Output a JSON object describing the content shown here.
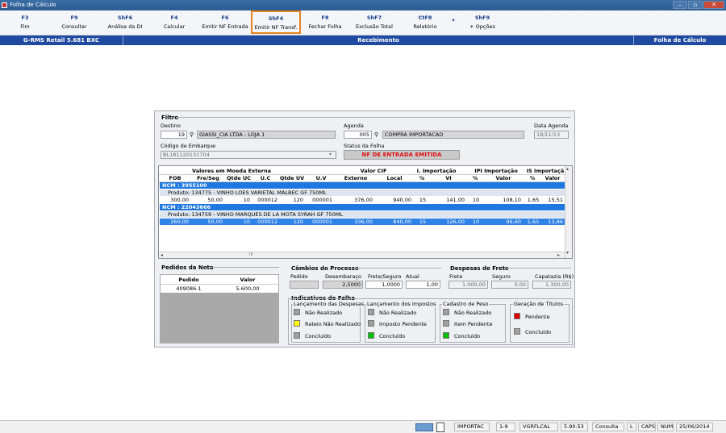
{
  "window": {
    "title": "Folha de Cálculo",
    "minimize": "–",
    "maximize": "▫",
    "close": "✕"
  },
  "toolbar": [
    {
      "key": "F3",
      "label": "Fim"
    },
    {
      "key": "F9",
      "label": "Consultar"
    },
    {
      "key": "ShF6",
      "label": "Análise da DI"
    },
    {
      "key": "F4",
      "label": "Calcular"
    },
    {
      "key": "F6",
      "label": "Emitir NF Entrada"
    },
    {
      "key": "ShF4",
      "label": "Emitir NF Transf."
    },
    {
      "key": "F8",
      "label": "Fechar Folha"
    },
    {
      "key": "ShF7",
      "label": "Exclusão Total"
    },
    {
      "key": "CtF8",
      "label": "Relatório"
    },
    {
      "key": "ShF9",
      "label": "+ Opções"
    }
  ],
  "header": {
    "left": "G-RMS Retail 5.681 BXC",
    "center": "Recebimento",
    "right": "Folha de Cálculo"
  },
  "filtro": {
    "title": "Filtro",
    "destino_label": "Destino",
    "destino_code": "19",
    "destino_name": "GIASSI_CIA LTDA - LOJA 1",
    "agenda_label": "Agenda",
    "agenda_code": "005",
    "agenda_name": "COMPRA IMPORTACAO",
    "data_agenda_label": "Data Agenda",
    "data_agenda": "18/11/13",
    "codigo_embarque_label": "Código de Embarque",
    "codigo_embarque": "BL181120131704",
    "status_label": "Status da Folha",
    "status": "NF DE ENTRADA EMITIDA"
  },
  "grid": {
    "group_headers": [
      "Valores em Moeda Externa",
      "Valor CIF",
      "I. Importação",
      "IPI Importação",
      "IS Importaçã"
    ],
    "columns": [
      "FOB",
      "Fre/Seg",
      "Qtde UC",
      "U.C",
      "Qtde UV",
      "U.V",
      "Externo",
      "Local",
      "%",
      "VI",
      "%",
      "Valor",
      "%",
      "Valor"
    ],
    "groups": [
      {
        "ncm": "NCM : 3955100",
        "product": "Produto: 134775 - VINHO LOES VARIETAL MALBEC    GF 750ML",
        "row": [
          "300,00",
          "50,00",
          "10",
          "000012",
          "120",
          "000001",
          "376,00",
          "940,00",
          "15",
          "141,00",
          "10",
          "108,10",
          "1,65",
          "15,51"
        ]
      },
      {
        "ncm": "NCM : 22043666",
        "product": "Produto: 134759 - VINHO MARQUES DE LA MOTA SYRAH  GF 750ML",
        "row": [
          "260,00",
          "50,00",
          "10",
          "000012",
          "120",
          "000001",
          "336,00",
          "840,00",
          "15",
          "126,00",
          "10",
          "96,60",
          "1,65",
          "13,86"
        ]
      }
    ],
    "scroll_left": "◂",
    "scroll_right": "▸",
    "scroll_up": "▴",
    "scroll_down": "▾",
    "scroll_thumb": "III"
  },
  "pedidos": {
    "title": "Pedidos da Nota",
    "col_pedido": "Pedido",
    "col_valor": "Valor",
    "pedido": "409086-1",
    "valor": "5.600,00"
  },
  "cambios": {
    "title": "Câmbios do Processo",
    "pedido_label": "Pedido",
    "desembaraco_label": "Desembaraço",
    "frete_label": "Frete/Seguro",
    "atual_label": "Atual",
    "pedido": "",
    "desembaraco": "2,5000",
    "frete": "1,0000",
    "atual": "1,00"
  },
  "despesas": {
    "title": "Despesas de Frete",
    "frete_label": "Frete",
    "seguro_label": "Seguro",
    "capatazia_label": "Capatazia (R$)",
    "frete": "1.000,00",
    "seguro": "0,00",
    "capatazia": "1.300,00"
  },
  "indicativos": {
    "title": "Indicativos de Falha",
    "groups": [
      {
        "title": "Lançamento das Despesas",
        "items": [
          {
            "label": "Não Realizado",
            "color": "#a0a0a0"
          },
          {
            "label": "Rateio Não Realizado",
            "color": "#ffff00"
          },
          {
            "label": "Concluído",
            "color": "#a0a0a0"
          }
        ]
      },
      {
        "title": "Lançamento dos Impostos",
        "items": [
          {
            "label": "Não Realizado",
            "color": "#a0a0a0"
          },
          {
            "label": "Imposto Pendente",
            "color": "#a0a0a0"
          },
          {
            "label": "Concluído",
            "color": "#00c000"
          }
        ]
      },
      {
        "title": "Cadastro de Peso",
        "items": [
          {
            "label": "Não Realizado",
            "color": "#a0a0a0"
          },
          {
            "label": "Item Pendente",
            "color": "#a0a0a0"
          },
          {
            "label": "Concluído",
            "color": "#00c000"
          }
        ]
      },
      {
        "title": "Geração de Títulos",
        "items": [
          {
            "label": "Pendente",
            "color": "#e00000"
          },
          {
            "label": "Concluído",
            "color": "#a0a0a0"
          }
        ]
      }
    ]
  },
  "statusbar": [
    "IMPORTAC",
    "1-9",
    "VGRFLCAL",
    "5.90.53",
    "Consulta",
    "L",
    "CAPS",
    "NUM",
    "25/06/2014"
  ]
}
